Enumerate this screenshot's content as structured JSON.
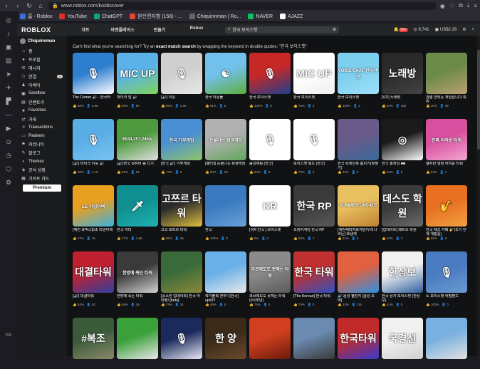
{
  "browser": {
    "url": "www.roblox.com/ko/discover",
    "bookmarks": [
      {
        "label": "홈 - Roblox",
        "color": "#3b6fd8"
      },
      {
        "label": "YouTube",
        "color": "#e52d27"
      },
      {
        "label": "ChatGPT",
        "color": "#10a37f"
      },
      {
        "label": "받은편지함 (156) - ...",
        "color": "#ea4335"
      },
      {
        "label": "Chiquinnman | Ro...",
        "color": "#666666"
      },
      {
        "label": "NAVER",
        "color": "#03c75a"
      },
      {
        "label": "AJAZZ",
        "color": "#ffffff"
      }
    ],
    "rail_bottom_label": "GX"
  },
  "topbar": {
    "logo": "ROBLOX",
    "nav": [
      "차트",
      "마켓플레이스",
      "만들기",
      "Robux"
    ],
    "search_value": "한국 보이스챗",
    "notif_count": "99+",
    "robux": "9,741",
    "currency": "US$2.26"
  },
  "sidebar": {
    "username": "Chiquinnman",
    "items": [
      {
        "label": "홈",
        "icon": "⌂",
        "badge": ""
      },
      {
        "label": "프로필",
        "icon": "●",
        "badge": ""
      },
      {
        "label": "메시지",
        "icon": "✉",
        "badge": ""
      },
      {
        "label": "연결",
        "icon": "⚇",
        "badge": "2k"
      },
      {
        "label": "아바타",
        "icon": "♟",
        "badge": ""
      },
      {
        "label": "Sandbox",
        "icon": "▣",
        "badge": ""
      },
      {
        "label": "인벤토리",
        "icon": "▤",
        "badge": ""
      },
      {
        "label": "Favorites",
        "icon": "★",
        "badge": ""
      },
      {
        "label": "거래",
        "icon": "⇄",
        "badge": ""
      },
      {
        "label": "Transactions",
        "icon": "≡",
        "badge": ""
      },
      {
        "label": "Redeem",
        "icon": "▭",
        "badge": ""
      },
      {
        "label": "커뮤니티",
        "icon": "⚑",
        "badge": ""
      },
      {
        "label": "블로그",
        "icon": "✎",
        "badge": ""
      },
      {
        "label": "Themes",
        "icon": "◐",
        "badge": ""
      },
      {
        "label": "공식 상점",
        "icon": "◈",
        "badge": ""
      },
      {
        "label": "기프트 카드",
        "icon": "▦",
        "badge": ""
      }
    ],
    "premium_label": "Premium"
  },
  "notice": {
    "before": "Can't find what you're searching for? Try an ",
    "bold": "exact match search",
    "after": " by wrapping the keyword in double quotes: \"한국 보이스챗\""
  },
  "games": [
    [
      {
        "title": "The Corner 🔊 - 한국어",
        "like": "88%",
        "players": "2.5K",
        "colors": [
          "#2f7fd1",
          "#ffffff"
        ],
        "icon": "🎙"
      },
      {
        "title": "마이크 업 🔊",
        "like": "89%",
        "players": "5K",
        "colors": [
          "#5ab2e8",
          "#7fd35a"
        ],
        "icon": "MIC UP"
      },
      {
        "title": "[🔊] 이웃",
        "like": "89%",
        "players": "4.3K",
        "colors": [
          "#cfcfcf",
          "#e8e8e8"
        ],
        "icon": "🎙"
      },
      {
        "title": "한국 아웃풀",
        "like": "61%",
        "players": "0",
        "colors": [
          "#72c0ec",
          "#5fae3c"
        ],
        "icon": "☯"
      },
      {
        "title": "한국 보이스챗",
        "like": "100%",
        "players": "0",
        "colors": [
          "#c62828",
          "#1e3f8c"
        ],
        "icon": "🎙"
      },
      {
        "title": "한국 보이스챗",
        "like": "75%",
        "players": "0",
        "colors": [
          "#ffffff",
          "#f0f0f0"
        ],
        "icon": "MIC UP"
      },
      {
        "title": "한국 보이스챗",
        "like": "100%",
        "players": "2",
        "colors": [
          "#7ccfef",
          "#9ee0f8"
        ],
        "icon": "VOICE CHAT 한국 버전"
      },
      {
        "title": "[V2!] 노래방",
        "like": "83%",
        "players": "182",
        "colors": [
          "#2a2a2a",
          "#444444"
        ],
        "icon": "노래방"
      },
      {
        "title": "검열 안되는 게임입니다 뭐위",
        "like": "40%",
        "players": "39",
        "colors": [
          "#6c8a4a",
          "#b8a070"
        ],
        "icon": ""
      }
    ],
    [
      {
        "title": "[🔊] 마이크 이웃 🔊",
        "like": "88%",
        "players": "1.1K",
        "colors": [
          "#5aaee6",
          "#78c4f2"
        ],
        "icon": "🎙"
      },
      {
        "title": "[🔊]한국 유튜버 롤 다기",
        "like": "82%",
        "players": "51",
        "colors": [
          "#4f9a3f",
          "#e0e0e0"
        ],
        "icon": "$534,257,245/s"
      },
      {
        "title": "[한국 🔊] 기부게임",
        "like": "73%",
        "players": "0",
        "colors": [
          "#4a8fd3",
          "#8fc56b"
        ],
        "icon": "한국 기부게임"
      },
      {
        "title": "[챌터3] 눈물나는 화생게임",
        "like": "90%",
        "players": "30",
        "colors": [
          "#b0b0b0",
          "#5fa85a"
        ],
        "icon": "눈물나는 희생게임"
      },
      {
        "title": "음성채팅 (한국)",
        "like": "64%",
        "players": "0",
        "colors": [
          "#ffffff",
          "#ffffff"
        ],
        "icon": "🎙"
      },
      {
        "title": "보이스챗 월드 (한국)",
        "like": "78%",
        "players": "0",
        "colors": [
          "#ffffff",
          "#ffffff"
        ],
        "icon": "🎙"
      },
      {
        "title": "한국 브레인롯 훔치기(맞찾기)",
        "like": "42%",
        "players": "0",
        "colors": [
          "#6a5a8a",
          "#3a6a9a"
        ],
        "icon": ""
      },
      {
        "title": "한국 총게임 ■■",
        "like": "83%",
        "players": "0",
        "colors": [
          "#1a1a1a",
          "#ffffff"
        ],
        "icon": "◎"
      },
      {
        "title": "챌지만 엄청 어려운 타워",
        "like": "84%",
        "players": "1",
        "colors": [
          "#d94fa0",
          "#f3a6d0"
        ],
        "icon": "진짜 어려운 타워"
      }
    ],
    [
      {
        "title": "[깨천 로벅스]5초 타임어택",
        "like": "27%",
        "players": "15",
        "colors": [
          "#e8a020",
          "#3cb0e0"
        ],
        "icon": "5초 타임어택"
      },
      {
        "title": "한국 어더",
        "like": "77%",
        "players": "1.6K",
        "colors": [
          "#0f8f8f",
          "#1fb0b0"
        ],
        "icon": "🗡"
      },
      {
        "title": "고고 표쯔르 타워",
        "like": "85%",
        "players": "36",
        "colors": [
          "#2a2a2a",
          "#e0c040"
        ],
        "icon": "고쯔르 타워"
      },
      {
        "title": "한국",
        "like": "100%",
        "players": "0",
        "colors": [
          "#3a7ac0",
          "#6aa0d8"
        ],
        "icon": ""
      },
      {
        "title": "[ KR 한국 ] 보이스챗",
        "like": "0%",
        "players": "0",
        "colors": [
          "#ffffff",
          "#ffffff"
        ],
        "icon": "KR"
      },
      {
        "title": "오징어게임 한국 RP",
        "like": "86%",
        "players": "1",
        "colors": [
          "#3a3a3a",
          "#5a5a5a"
        ],
        "icon": "한국 RP"
      },
      {
        "title": "[게임쎄터여로게임!우리나라는] 화생게",
        "like": "51%",
        "players": "0",
        "colors": [
          "#e8c060",
          "#c08030"
        ],
        "icon": "SUMMER UPDATE"
      },
      {
        "title": "[업데이트] 돼트도 학원",
        "like": "63%",
        "players": "7",
        "colors": [
          "#3a3a3a",
          "#6a6a6a"
        ],
        "icon": "데스도 학원"
      },
      {
        "title": "한국 재즈 카페 🎷(초기 단계 개발중)",
        "like": "90%",
        "players": "0",
        "colors": [
          "#e87020",
          "#f0a040"
        ],
        "icon": "🎷"
      }
    ],
    [
      {
        "title": "[🔊] 대결타워",
        "like": "54%",
        "players": "63",
        "colors": [
          "#c02030",
          "#3040a0"
        ],
        "icon": "대결타워"
      },
      {
        "title": "한방에 죽는 타워",
        "like": "58%",
        "players": "38",
        "colors": [
          "#3a3a3a",
          "#d0d0d0"
        ],
        "icon": "한방에 죽는 타워"
      },
      {
        "title": "[소소한 업데이트] 한국 어려웠! [beta]",
        "like": "79%",
        "players": "31",
        "colors": [
          "#3a6a3a",
          "#8a8a3a"
        ],
        "icon": ""
      },
      {
        "title": "학기블록 전투!! [한국] upd2!!",
        "like": "49%",
        "players": "0",
        "colors": [
          "#6ab0e8",
          "#e8e8e8"
        ],
        "icon": ""
      },
      {
        "title": "코브레도도 못해는 타워 (0.5주년)",
        "like": "75%",
        "players": "0",
        "colors": [
          "#8a8a8a",
          "#5a5a5a"
        ],
        "icon": "주르레도도 못해는 타워"
      },
      {
        "title": "[The Korean] 한국 타워",
        "like": "75%",
        "players": "0",
        "colors": [
          "#c03030",
          "#3050c0"
        ],
        "icon": "한국 타워"
      },
      {
        "title": "🔊 음성 챌린지 [음성 오바]",
        "like": "33%",
        "players": "116",
        "colors": [
          "#e06040",
          "#3090e0"
        ],
        "icon": ""
      },
      {
        "title": "한국 상가 보이스챗 (한상보)",
        "like": "52%",
        "players": "0",
        "colors": [
          "#f0f0f0",
          "#3060a0"
        ],
        "icon": "한상보"
      },
      {
        "title": "노 보이스챗 어필팬드",
        "like": "100%",
        "players": "0",
        "colors": [
          "#4a7ac0",
          "#6a9ad0"
        ],
        "icon": "🎙"
      }
    ],
    [
      {
        "title": "",
        "like": "",
        "players": "",
        "colors": [
          "#3a5a3a",
          "#8a8a6a"
        ],
        "icon": "#복조"
      },
      {
        "title": "",
        "like": "",
        "players": "",
        "colors": [
          "#3aa03a",
          "#e8e8e8"
        ],
        "icon": ""
      },
      {
        "title": "",
        "like": "",
        "players": "",
        "colors": [
          "#1a2a5a",
          "#e8e8f8"
        ],
        "icon": "🎙"
      },
      {
        "title": "",
        "like": "",
        "players": "",
        "colors": [
          "#3a2a1a",
          "#6a4a2a"
        ],
        "icon": "한 양"
      },
      {
        "title": "",
        "like": "",
        "players": "",
        "colors": [
          "#d04020",
          "#6a1a0a"
        ],
        "icon": ""
      },
      {
        "title": "",
        "like": "",
        "players": "",
        "colors": [
          "#6a8ab0",
          "#3a3a3a"
        ],
        "icon": ""
      },
      {
        "title": "",
        "like": "",
        "players": "",
        "colors": [
          "#c02a2a",
          "#3a3ad0"
        ],
        "icon": "한국타워"
      },
      {
        "title": "",
        "like": "",
        "players": "",
        "colors": [
          "#f0f0f0",
          "#d0d0d0"
        ],
        "icon": "국경선"
      },
      {
        "title": "",
        "like": "",
        "players": "",
        "colors": [
          "#7ab0e0",
          "#e0e0e0"
        ],
        "icon": ""
      }
    ]
  ]
}
